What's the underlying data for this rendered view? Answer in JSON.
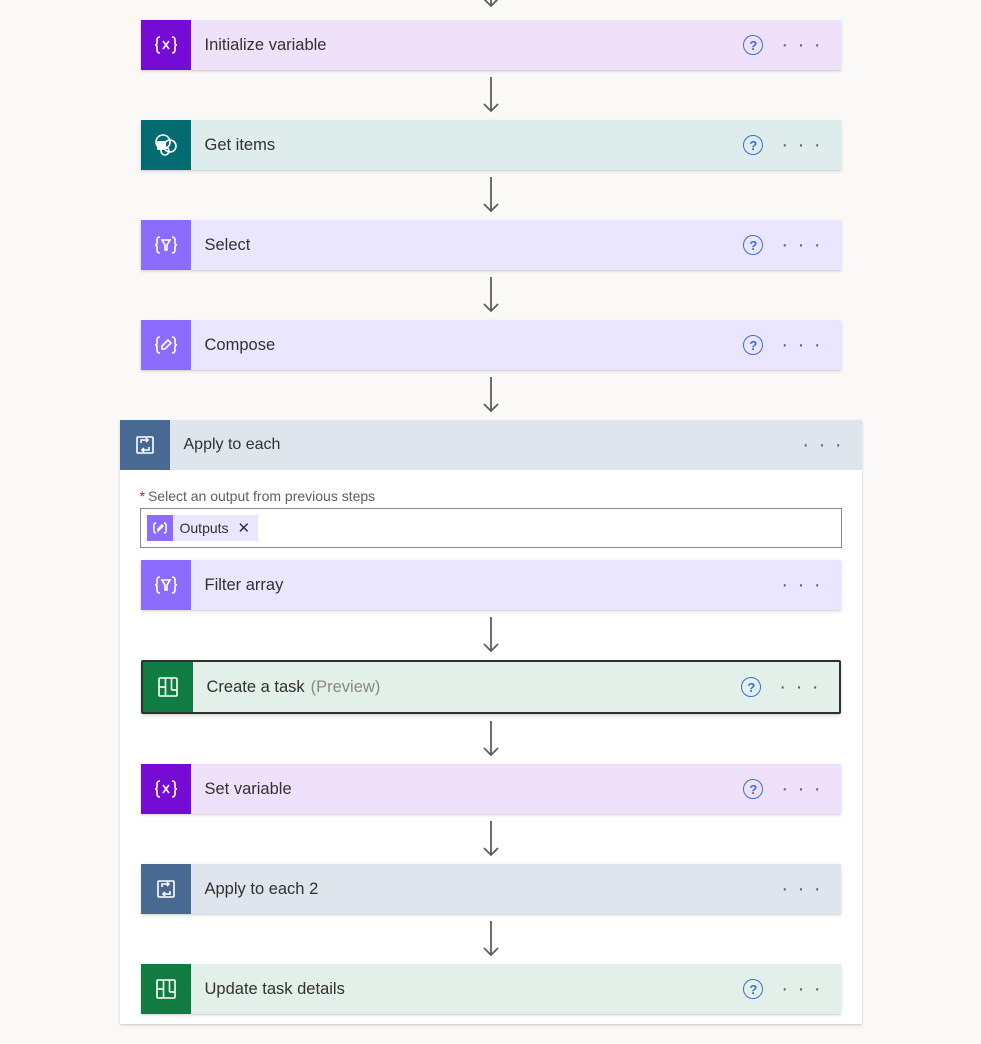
{
  "outer_steps": [
    {
      "id": "init-var",
      "label": "Initialize variable",
      "theme": "variable",
      "icon": "brace-x",
      "help": true
    },
    {
      "id": "get-items",
      "label": "Get items",
      "theme": "sharepoint",
      "icon": "sp",
      "help": true
    },
    {
      "id": "select",
      "label": "Select",
      "theme": "dataop",
      "icon": "funnel",
      "help": true
    },
    {
      "id": "compose",
      "label": "Compose",
      "theme": "dataop",
      "icon": "pencil",
      "help": true
    }
  ],
  "container": {
    "label": "Apply to each",
    "param_label": "Select an output from previous steps",
    "token_label": "Outputs",
    "inner_steps": [
      {
        "id": "filter",
        "label": "Filter array",
        "theme": "dataop",
        "icon": "funnel",
        "help": false
      },
      {
        "id": "create-task",
        "label": "Create a task",
        "preview": "(Preview)",
        "theme": "planner",
        "icon": "planner",
        "help": true,
        "selected": true
      },
      {
        "id": "set-var",
        "label": "Set variable",
        "theme": "variable",
        "icon": "brace-x",
        "help": true
      },
      {
        "id": "apply2",
        "label": "Apply to each 2",
        "theme": "control",
        "icon": "loop",
        "help": false
      },
      {
        "id": "update-task",
        "label": "Update task details",
        "theme": "planner",
        "icon": "planner",
        "help": true
      }
    ]
  }
}
